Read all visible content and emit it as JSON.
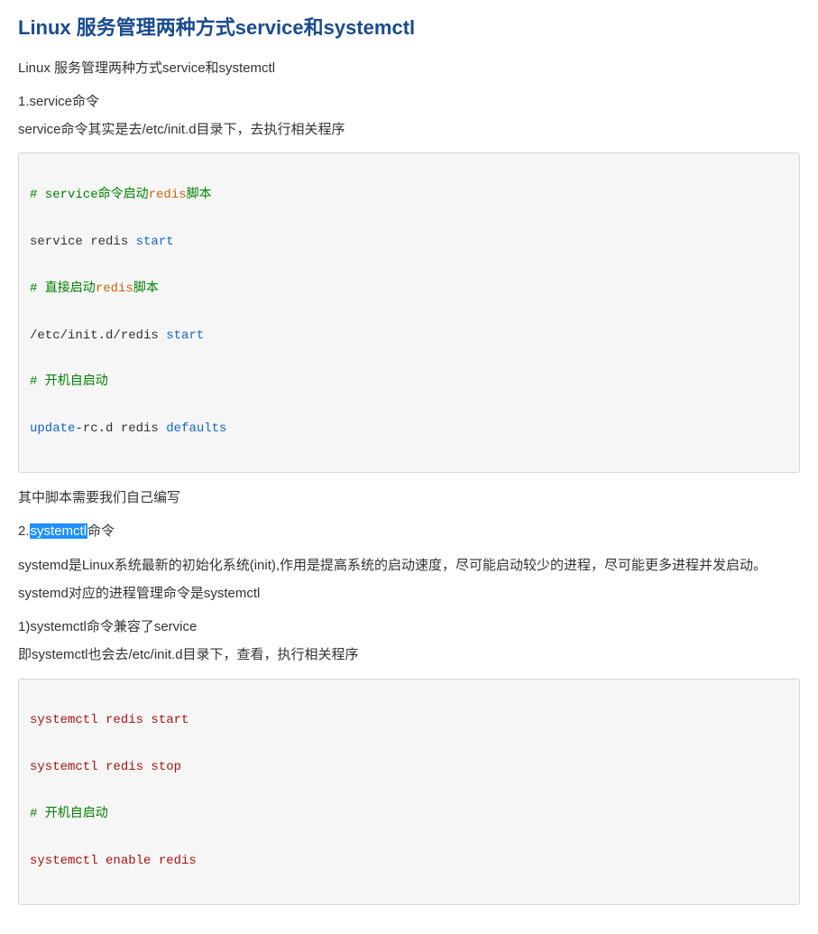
{
  "title": "Linux 服务管理两种方式service和systemctl",
  "p_intro": "Linux 服务管理两种方式service和systemctl",
  "sec1_heading": "1.service命令",
  "sec1_desc": "service命令其实是去/etc/init.d目录下，去执行相关程序",
  "code1": {
    "l1a_hash": "# service",
    "l1a_mid": "命令启动",
    "l1a_redis": "redis",
    "l1a_tail": "脚本",
    "l2_cmd": "service redis ",
    "l2_start": "start",
    "l3_hash": "# 直接启动",
    "l3_redis": "redis",
    "l3_tail": "脚本",
    "l4_path": "/etc/init.d/redis ",
    "l4_start": "start",
    "l5_hash": "# 开机自启动",
    "l6_update": "update",
    "l6_mid": "-rc.d redis ",
    "l6_defaults": "defaults"
  },
  "sec1_note": "其中脚本需要我们自己编写",
  "sec2_prefix": "2.",
  "sec2_hl": "systemctl",
  "sec2_suffix": "命令",
  "sec2_p1": "systemd是Linux系统最新的初始化系统(init),作用是提高系统的启动速度，尽可能启动较少的进程，尽可能更多进程并发启动。",
  "sec2_p2": "systemd对应的进程管理命令是systemctl",
  "sec2_sub1": "1)systemctl命令兼容了service",
  "sec2_sub1_desc": "即systemctl也会去/etc/init.d目录下，查看，执行相关程序",
  "code2": {
    "l1": "systemctl redis start",
    "l2": "systemctl redis stop",
    "l3_hash": "# 开机自启动",
    "l4": "systemctl enable redis"
  }
}
